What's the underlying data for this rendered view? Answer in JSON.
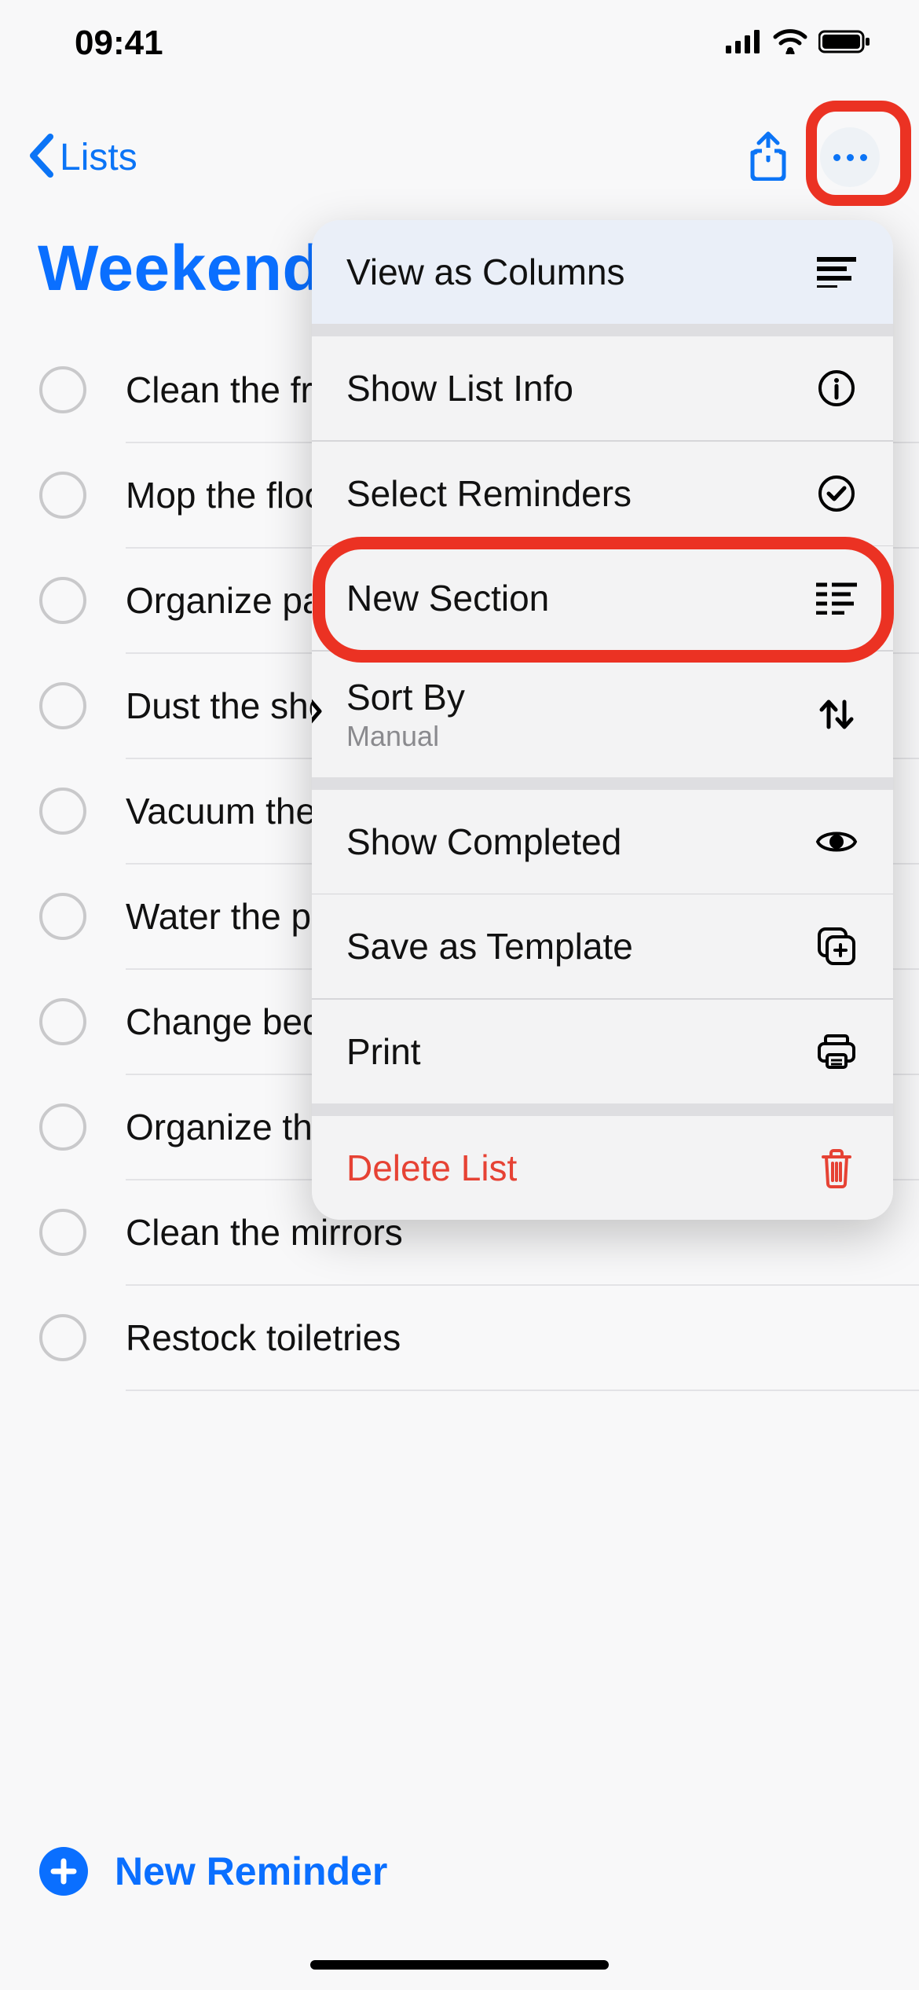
{
  "status": {
    "time": "09:41"
  },
  "nav": {
    "back_label": "Lists"
  },
  "list_title": "Weekend chores",
  "reminders": [
    "Clean the fridge",
    "Mop the floors",
    "Organize pantry",
    "Dust the shelves",
    "Vacuum the carpet",
    "Water the plants",
    "Change bed sheets",
    "Organize the closet",
    "Clean the mirrors",
    "Restock toiletries"
  ],
  "menu": {
    "view_as_columns": "View as Columns",
    "show_list_info": "Show List Info",
    "select_reminders": "Select Reminders",
    "new_section": "New Section",
    "sort_by": "Sort By",
    "sort_value": "Manual",
    "show_completed": "Show Completed",
    "save_template": "Save as Template",
    "print": "Print",
    "delete_list": "Delete List"
  },
  "bottom": {
    "new_reminder": "New Reminder"
  }
}
